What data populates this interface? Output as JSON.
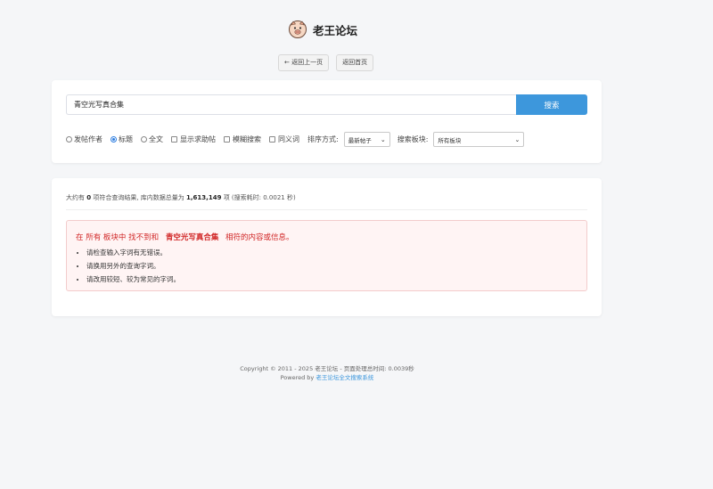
{
  "header": {
    "title": "老王论坛",
    "logo_icon": "pig-face-icon"
  },
  "nav": {
    "back": "← 返回上一页",
    "home": "返回首页"
  },
  "search": {
    "query": "青空光写真合集",
    "button": "搜索"
  },
  "options": {
    "author": "发帖作者",
    "title": "标题",
    "fulltext": "全文",
    "show_help": "显示求助帖",
    "fuzzy": "模糊搜索",
    "synonym": "同义词",
    "sort_label": "排序方式:",
    "sort_value": "最新帖子",
    "board_label": "搜索板块:",
    "board_value": "所有板块",
    "selected": "title"
  },
  "results": {
    "prefix": "大约有",
    "count": "0",
    "mid": "项符合查询结果, 库内数据总量为",
    "total": "1,613,149",
    "suffix": "项 (搜索耗时: 0.0021 秒)"
  },
  "alert": {
    "prefix": "在 所有 板块中 找不到和",
    "keyword": "青空光写真合集",
    "suffix": "相符的内容或信息。",
    "tips": [
      "请检查输入字词有无错误。",
      "请换用另外的查询字词。",
      "请改用较短、较为常见的字词。"
    ]
  },
  "footer": {
    "line1": "Copyright © 2011 - 2025 老王论坛 - 页面处理总时间: 0.0039秒",
    "powered": "Powered by",
    "link": "老王论坛全文搜索系统"
  },
  "colors": {
    "accent": "#3d97dc",
    "error": "#d12626",
    "alert_bg": "#fff4f4"
  }
}
